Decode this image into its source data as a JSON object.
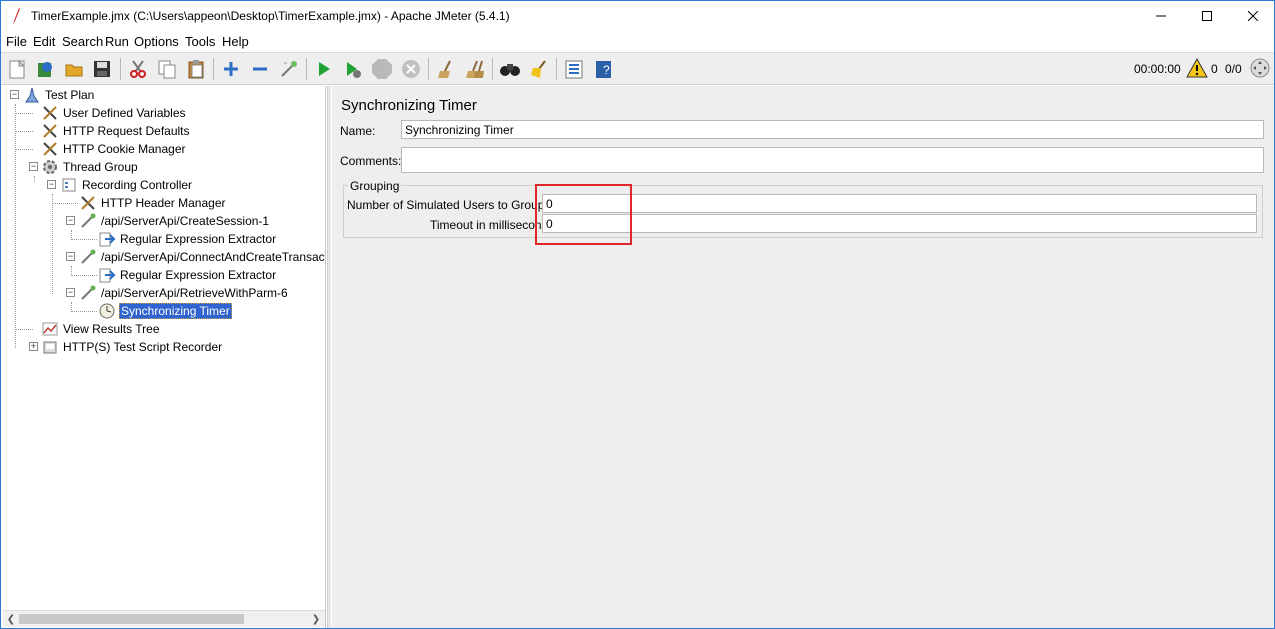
{
  "window": {
    "title": "TimerExample.jmx (C:\\Users\\appeon\\Desktop\\TimerExample.jmx) - Apache JMeter (5.4.1)"
  },
  "menu": {
    "items": [
      "File",
      "Edit",
      "Search",
      "Run",
      "Options",
      "Tools",
      "Help"
    ]
  },
  "toolbar": {
    "elapsed_time": "00:00:00",
    "warning_count": "0",
    "threads": "0/0"
  },
  "tree": {
    "items": [
      {
        "label": "Test Plan",
        "icon": "test-plan-icon"
      },
      {
        "label": "User Defined Variables",
        "icon": "config-wrench-icon"
      },
      {
        "label": "HTTP Request Defaults",
        "icon": "config-wrench-icon"
      },
      {
        "label": "HTTP Cookie Manager",
        "icon": "config-wrench-icon"
      },
      {
        "label": "Thread Group",
        "icon": "thread-group-gear-icon"
      },
      {
        "label": "Recording Controller",
        "icon": "controller-icon"
      },
      {
        "label": "HTTP Header Manager",
        "icon": "config-wrench-icon"
      },
      {
        "label": "/api/ServerApi/CreateSession-1",
        "icon": "sampler-pipette-icon"
      },
      {
        "label": "Regular Expression Extractor",
        "icon": "post-processor-arrow-icon"
      },
      {
        "label": "/api/ServerApi/ConnectAndCreateTransaction-",
        "icon": "sampler-pipette-icon"
      },
      {
        "label": "Regular Expression Extractor",
        "icon": "post-processor-arrow-icon"
      },
      {
        "label": "/api/ServerApi/RetrieveWithParm-6",
        "icon": "sampler-pipette-icon"
      },
      {
        "label": "Synchronizing Timer",
        "icon": "timer-clock-icon",
        "selected": true
      },
      {
        "label": "View Results Tree",
        "icon": "listener-graph-icon"
      },
      {
        "label": "HTTP(S) Test Script Recorder",
        "icon": "recorder-icon"
      }
    ]
  },
  "form": {
    "title": "Synchronizing Timer",
    "name_label": "Name:",
    "name_value": "Synchronizing Timer",
    "comments_label": "Comments:",
    "comments_value": "",
    "group_title": "Grouping",
    "users_label": "Number of Simulated Users to Group by:",
    "users_value": "0",
    "timeout_label": "Timeout in milliseconds:",
    "timeout_value": "0"
  },
  "colors": {
    "selection": "#2f63cf",
    "highlight_border": "#e0262b",
    "panel_background": "#eeeeee"
  }
}
